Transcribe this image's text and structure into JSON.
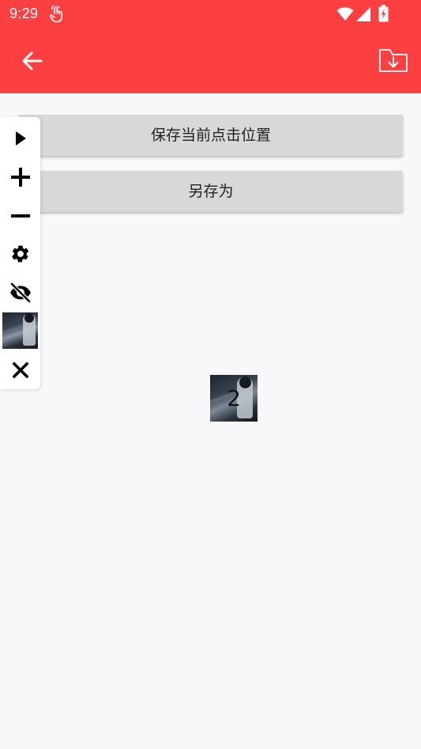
{
  "status_bar": {
    "time": "9:29",
    "background": "#fc3f41",
    "icons": [
      "touch-icon",
      "wifi-icon",
      "signal-icon",
      "battery-charging-icon"
    ]
  },
  "app_bar": {
    "background": "#fc3f41",
    "back_icon": "arrow-back-icon",
    "save_icon": "folder-download-icon"
  },
  "actions": {
    "save_position_label": "保存当前点击位置",
    "save_as_label": "另存为"
  },
  "floating_toolbar": {
    "items": [
      "play-icon",
      "plus-icon",
      "minus-icon",
      "gear-icon",
      "eye-off-icon",
      "thumbnail-image",
      "close-icon"
    ]
  },
  "click_marker": {
    "label": "2"
  }
}
